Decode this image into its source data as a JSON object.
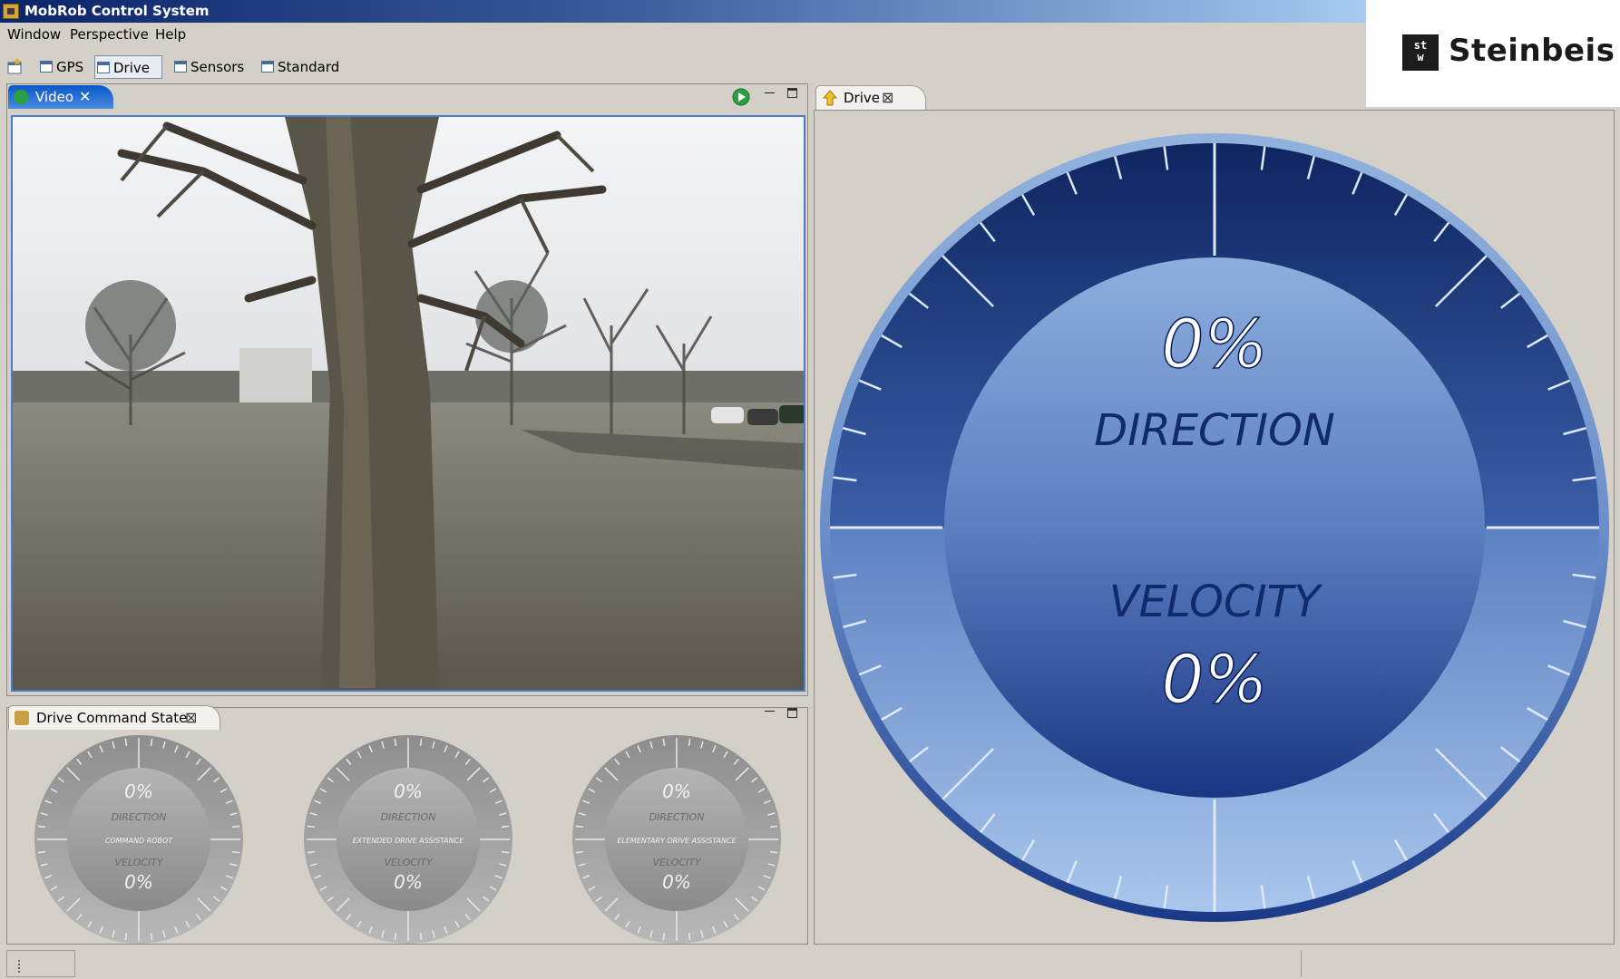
{
  "window": {
    "title": "MobRob Control System"
  },
  "logo": {
    "mark": "st\nw",
    "text": "Steinbeis"
  },
  "menu": {
    "items": [
      "Window",
      "Perspective",
      "Help"
    ]
  },
  "perspectives": {
    "items": [
      "GPS",
      "Drive",
      "Sensors",
      "Standard"
    ],
    "active": "Drive"
  },
  "video_panel": {
    "tab_label": "Video",
    "close_glyph": "✕"
  },
  "drive_panel": {
    "tab_label": "Drive",
    "close_glyph": "⊠"
  },
  "command_panel": {
    "tab_label": "Drive Command State",
    "close_glyph": "⊠"
  },
  "main_gauge": {
    "direction_value": "0%",
    "direction_label": "DIRECTION",
    "velocity_label": "VELOCITY",
    "velocity_value": "0%"
  },
  "small_gauges": [
    {
      "direction_value": "0%",
      "direction_label": "DIRECTION",
      "mode_label": "COMMAND ROBOT",
      "velocity_label": "VELOCITY",
      "velocity_value": "0%"
    },
    {
      "direction_value": "0%",
      "direction_label": "DIRECTION",
      "mode_label": "EXTENDED DRIVE ASSISTANCE",
      "velocity_label": "VELOCITY",
      "velocity_value": "0%"
    },
    {
      "direction_value": "0%",
      "direction_label": "DIRECTION",
      "mode_label": "ELEMENTARY DRIVE ASSISTANCE",
      "velocity_label": "VELOCITY",
      "velocity_value": "0%"
    }
  ],
  "colors": {
    "titlebar_start": "#0a246a",
    "gauge_dark": "#13307a",
    "gauge_light": "#8fb0dc",
    "gauge_text": "#ffffff",
    "gauge_label": "#102a6a",
    "small_gauge": "#a0a0a0"
  }
}
